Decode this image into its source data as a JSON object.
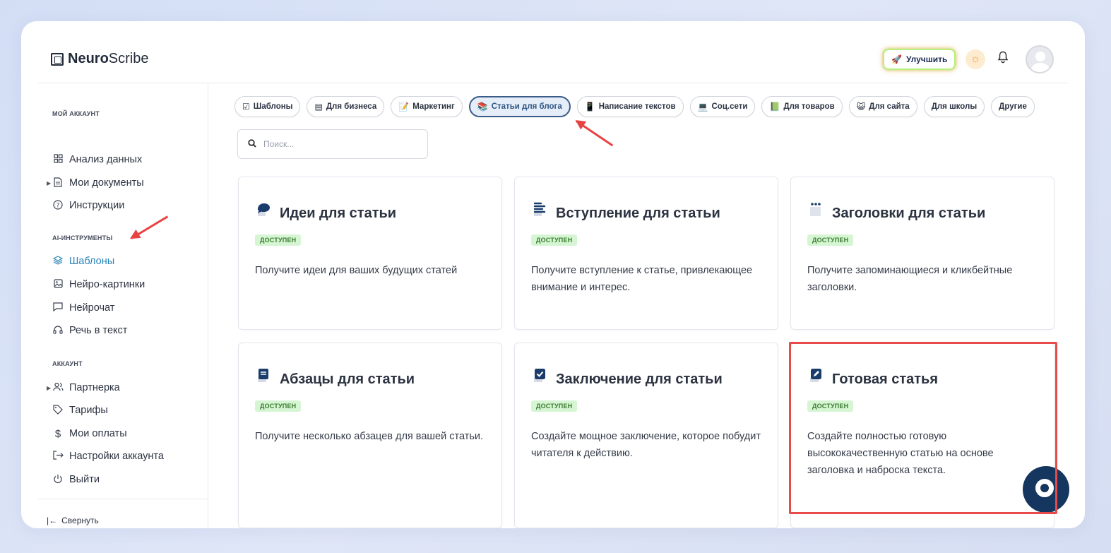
{
  "app": {
    "logo_bold": "Neuro",
    "logo_rest": "Scribe"
  },
  "header": {
    "upgrade_label": "Улучшить"
  },
  "sidebar": {
    "sections": [
      {
        "title": "МОЙ АККАУНТ"
      },
      {
        "title": "AI-ИНСТРУМЕНТЫ"
      },
      {
        "title": "АККАУНТ"
      }
    ],
    "items": [
      {
        "label": "Анализ данных",
        "icon": "grid-icon"
      },
      {
        "label": "Мои документы",
        "icon": "document-icon"
      },
      {
        "label": "Инструкции",
        "icon": "help-icon"
      },
      {
        "label": "Шаблоны",
        "icon": "layers-icon"
      },
      {
        "label": "Нейро-картинки",
        "icon": "image-icon"
      },
      {
        "label": "Нейрочат",
        "icon": "chat-icon"
      },
      {
        "label": "Речь в текст",
        "icon": "headphones-icon"
      },
      {
        "label": "Партнерка",
        "icon": "users-icon"
      },
      {
        "label": "Тарифы",
        "icon": "tag-icon"
      },
      {
        "label": "Мои оплаты",
        "icon": "dollar-icon"
      },
      {
        "label": "Настройки аккаунта",
        "icon": "settings-exit-icon"
      },
      {
        "label": "Выйти",
        "icon": "power-icon"
      }
    ],
    "collapse_label": "Свернуть"
  },
  "categories": [
    {
      "label": "Шаблоны",
      "icon": "☑"
    },
    {
      "label": "Для бизнеса",
      "icon": "▤"
    },
    {
      "label": "Маркетинг",
      "icon": "📝"
    },
    {
      "label": "Статьи для блога",
      "icon": "📚"
    },
    {
      "label": "Написание текстов",
      "icon": "📱"
    },
    {
      "label": "Соц.сети",
      "icon": "💻"
    },
    {
      "label": "Для товаров",
      "icon": "📗"
    },
    {
      "label": "Для сайта",
      "icon": "😺"
    },
    {
      "label": "Для школы",
      "icon": ""
    },
    {
      "label": "Другие",
      "icon": ""
    }
  ],
  "search": {
    "placeholder": "Поиск..."
  },
  "cards": [
    {
      "title": "Идеи для статьи",
      "badge": "ДОСТУПЕН",
      "desc": "Получите идеи для ваших будущих статей",
      "icon": "speech-bubble-icon"
    },
    {
      "title": "Вступление для статьи",
      "badge": "ДОСТУПЕН",
      "desc": "Получите вступление к статье, привлекающее внимание и интерес.",
      "icon": "lines-icon"
    },
    {
      "title": "Заголовки для статьи",
      "badge": "ДОСТУПЕН",
      "desc": "Получите запоминающиеся и кликбейтные заголовки.",
      "icon": "dots-icon"
    },
    {
      "title": "Абзацы для статьи",
      "badge": "ДОСТУПЕН",
      "desc": "Получите несколько абзацев для вашей статьи.",
      "icon": "book-icon"
    },
    {
      "title": "Заключение для статьи",
      "badge": "ДОСТУПЕН",
      "desc": "Создайте мощное заключение, которое побудит читателя к действию.",
      "icon": "checkbox-icon"
    },
    {
      "title": "Готовая статья",
      "badge": "ДОСТУПЕН",
      "desc": "Создайте полностью готовую высококачественную статью на основе заголовка и наброска текста.",
      "icon": "pen-icon"
    }
  ],
  "colors": {
    "accent": "#2a84b8",
    "highlight": "#e84a4a",
    "badge_bg": "#d5f5d3",
    "fab": "#15365f"
  }
}
